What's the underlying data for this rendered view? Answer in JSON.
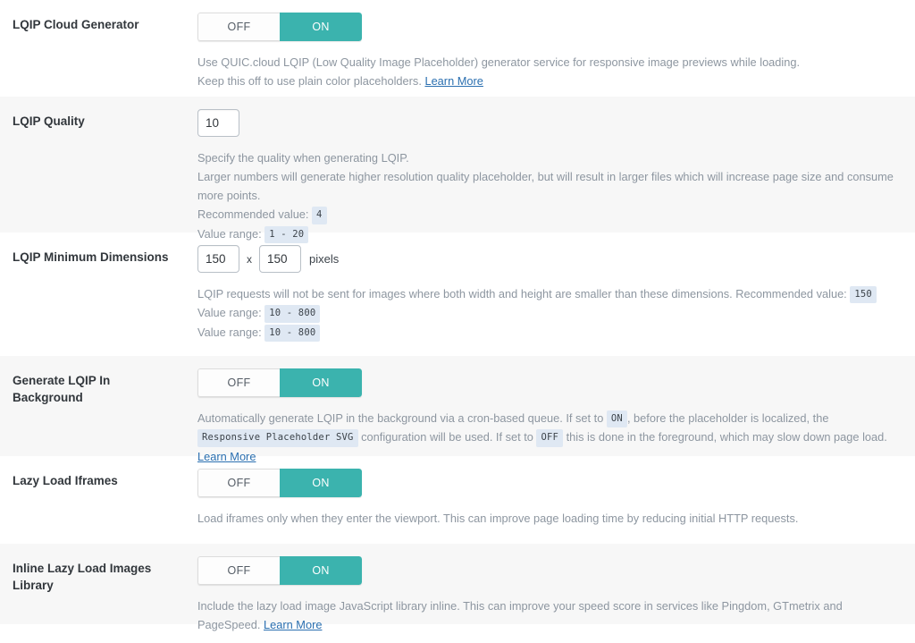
{
  "rows": [
    {
      "label": "LQIP Cloud Generator",
      "control": "toggle",
      "toggle": {
        "off_label": "OFF",
        "on_label": "ON",
        "state": "ON"
      },
      "desc_line1": "Use QUIC.cloud LQIP (Low Quality Image Placeholder) generator service for responsive image previews while loading.",
      "desc_line2_pre": "Keep this off to use plain color placeholders. ",
      "learn_more": "Learn More"
    },
    {
      "label": "LQIP Quality",
      "control": "number",
      "value": "10",
      "desc_line1": "Specify the quality when generating LQIP.",
      "desc_line2": "Larger numbers will generate higher resolution quality placeholder, but will result in larger files which will increase page size and consume more points.",
      "desc_line3_pre": "Recommended value: ",
      "recommended": "4",
      "desc_line4_pre": "Value range: ",
      "range": "1 - 20"
    },
    {
      "label": "LQIP Minimum Dimensions",
      "control": "dimensions",
      "width_value": "150",
      "height_value": "150",
      "separator": "x",
      "unit": "pixels",
      "desc_line1_pre": "LQIP requests will not be sent for images where both width and height are smaller than these dimensions. Recommended value: ",
      "recommended": "150",
      "desc_line2_pre": "Value range: ",
      "range1": "10 - 800",
      "desc_line3_pre": "Value range: ",
      "range2": "10 - 800"
    },
    {
      "label": "Generate LQIP In Background",
      "control": "toggle",
      "toggle": {
        "off_label": "OFF",
        "on_label": "ON",
        "state": "ON"
      },
      "desc_a": "Automatically generate LQIP in the background via a cron-based queue. If set to ",
      "code_on": "ON",
      "desc_b": ", before the placeholder is localized, the ",
      "code_svg": "Responsive Placeholder SVG",
      "desc_c": "configuration will be used. If set to ",
      "code_off": "OFF",
      "desc_d": " this is done in the foreground, which may slow down page load. ",
      "learn_more": "Learn More"
    },
    {
      "label": "Lazy Load Iframes",
      "control": "toggle",
      "toggle": {
        "off_label": "OFF",
        "on_label": "ON",
        "state": "ON"
      },
      "desc_line1": "Load iframes only when they enter the viewport. This can improve page loading time by reducing initial HTTP requests."
    },
    {
      "label": "Inline Lazy Load Images Library",
      "control": "toggle",
      "toggle": {
        "off_label": "OFF",
        "on_label": "ON",
        "state": "ON"
      },
      "desc_line1_pre": "Include the lazy load image JavaScript library inline. This can improve your speed score in services like Pingdom, GTmetrix and PageSpeed. ",
      "learn_more": "Learn More"
    }
  ],
  "colors": {
    "toggle_on": "#3bb3ae",
    "link": "#2a6fb0",
    "badge_bg": "#dfe8f3",
    "alt_row_bg": "#f7f7f7"
  }
}
